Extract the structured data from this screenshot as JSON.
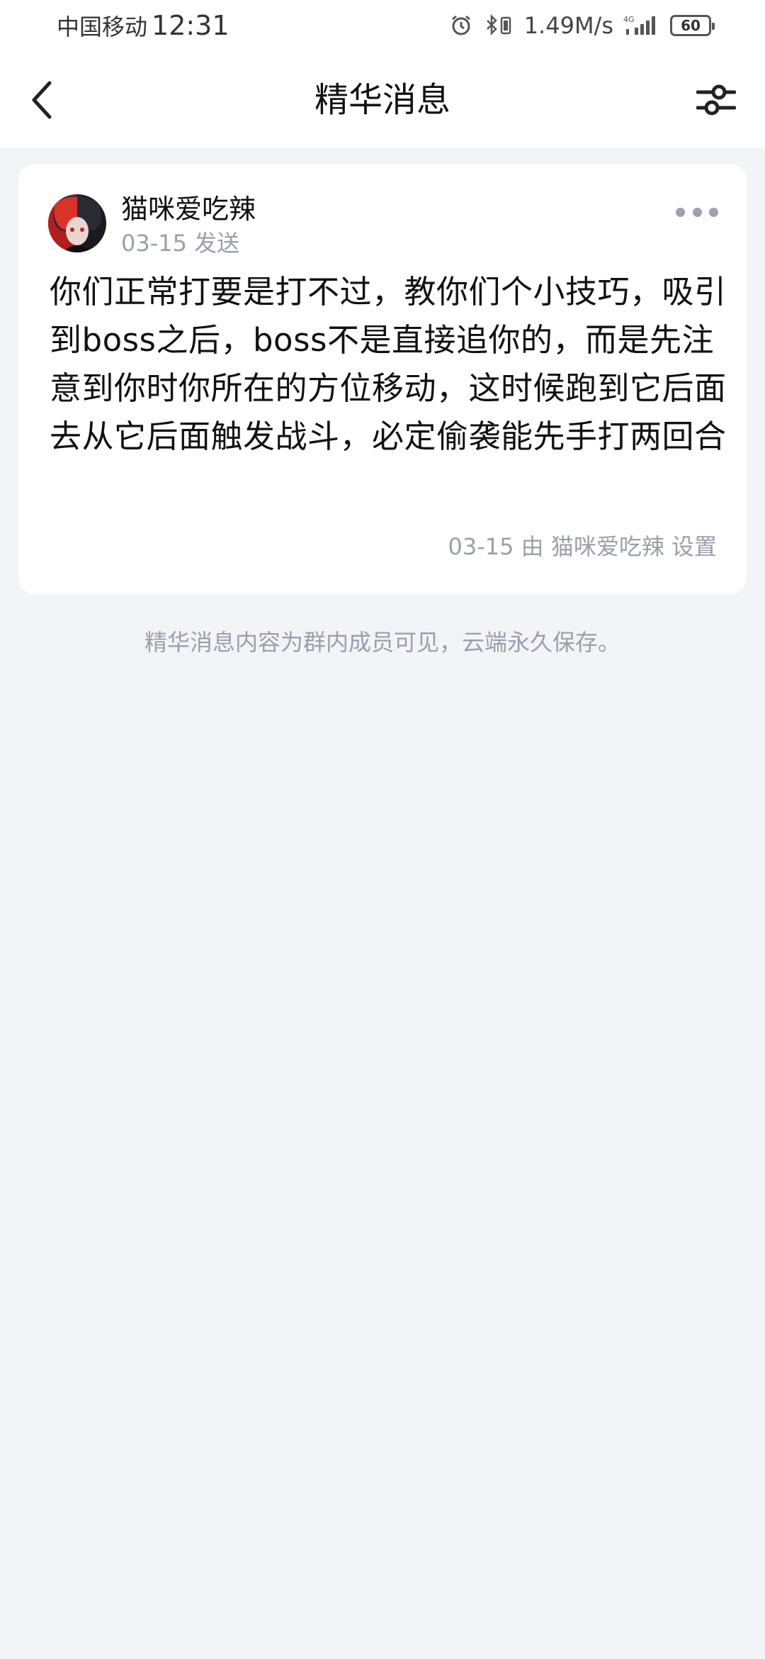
{
  "status_bar": {
    "carrier": "中国移动",
    "time": "12:31",
    "speed": "1.49M/s",
    "network": "4G",
    "battery": "60"
  },
  "nav": {
    "title": "精华消息"
  },
  "message": {
    "author": "猫咪爱吃辣",
    "time": "03-15 发送",
    "content": "你们正常打要是打不过，教你们个小技巧，吸引到boss之后，boss不是直接追你的，而是先注意到你时你所在的方位移动，这时候跑到它后面去从它后面触发战斗，必定偷袭能先手打两回合",
    "set_info": "03-15 由 猫咪爱吃辣 设置"
  },
  "footer_note": "精华消息内容为群内成员可见，云端永久保存。",
  "colors": {
    "background": "#f3f4f8",
    "card": "#ffffff",
    "secondary_text": "#9aa0ab"
  }
}
